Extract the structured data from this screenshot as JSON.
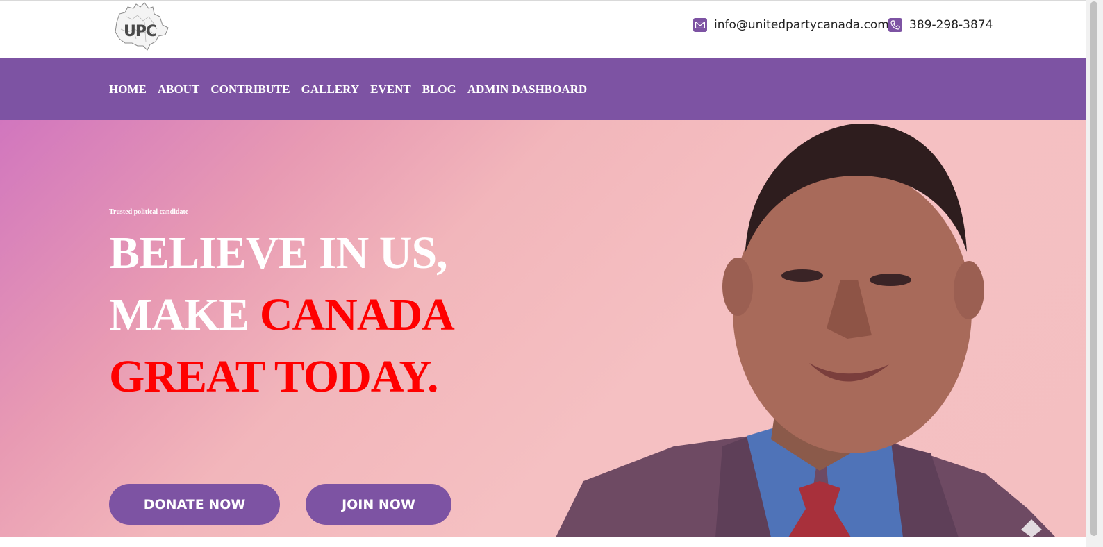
{
  "header": {
    "logo_text": "UPC",
    "email": "info@unitedpartycanada.com",
    "phone": "389-298-3874"
  },
  "nav": {
    "items": [
      "HOME",
      "ABOUT",
      "CONTRIBUTE",
      "GALLERY",
      "EVENT",
      "BLOG",
      "ADMIN DASHBOARD"
    ]
  },
  "hero": {
    "tagline": "Trusted political candidate",
    "line1": "BELIEVE IN US,",
    "line2_white": "MAKE ",
    "line2_red": "CANADA",
    "line3": "GREAT TODAY.",
    "donate_label": "DONATE NOW",
    "join_label": "JOIN NOW"
  },
  "colors": {
    "brand_purple": "#7d53a3",
    "headline_red": "#ff0000",
    "hero_pink": "#f4bfc1"
  },
  "icons": {
    "email": "envelope-icon",
    "phone": "phone-icon",
    "logo": "canada-map-logo"
  }
}
